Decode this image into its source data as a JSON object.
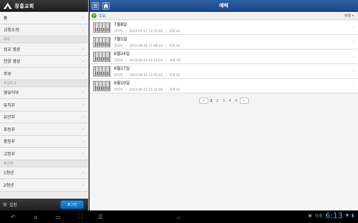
{
  "sidebar": {
    "title": "장흥교회",
    "items": [
      {
        "type": "item",
        "label": "홈"
      },
      {
        "type": "item",
        "label": "교회소개"
      },
      {
        "type": "section",
        "label": "예배"
      },
      {
        "type": "item",
        "label": "성교 영상"
      },
      {
        "type": "item",
        "label": "찬양 영상"
      },
      {
        "type": "item",
        "label": "주보"
      },
      {
        "type": "section",
        "label": "주일학교"
      },
      {
        "type": "item",
        "label": "영유아부"
      },
      {
        "type": "item",
        "label": "유치부"
      },
      {
        "type": "item",
        "label": "유년부"
      },
      {
        "type": "item",
        "label": "초등부"
      },
      {
        "type": "item",
        "label": "중등부"
      },
      {
        "type": "item",
        "label": "고등부"
      },
      {
        "type": "section",
        "label": "청년회"
      },
      {
        "type": "item",
        "label": "1청년"
      },
      {
        "type": "item",
        "label": "2청년"
      }
    ],
    "settings_label": "설정",
    "login_label": "로그인"
  },
  "topbar": {
    "title": "예배"
  },
  "subbar": {
    "category": "주보",
    "sort_label": "정렬"
  },
  "posts": [
    {
      "title": "7월8일",
      "author": "관리자",
      "date": "2012-07-07 12:55:46",
      "views": "조회 64"
    },
    {
      "title": "7월1일",
      "author": "관리자",
      "date": "2012-06-30 11:48:14",
      "views": "조회 64"
    },
    {
      "title": "6월24일",
      "author": "관리자",
      "date": "2012-06-23 12:29:53",
      "views": "조회 78"
    },
    {
      "title": "6월17일",
      "author": "관리자",
      "date": "2012-06-16 12:25:44",
      "views": "조회 62"
    },
    {
      "title": "6월10일",
      "author": "관리자",
      "date": "2012-06-10 15:12:46",
      "views": "조회 61"
    }
  ],
  "pagination": {
    "pages": [
      "1",
      "2",
      "3",
      "4",
      "5"
    ],
    "current": "1"
  },
  "statusbar": {
    "ampm": "오후",
    "time": "6:13"
  }
}
